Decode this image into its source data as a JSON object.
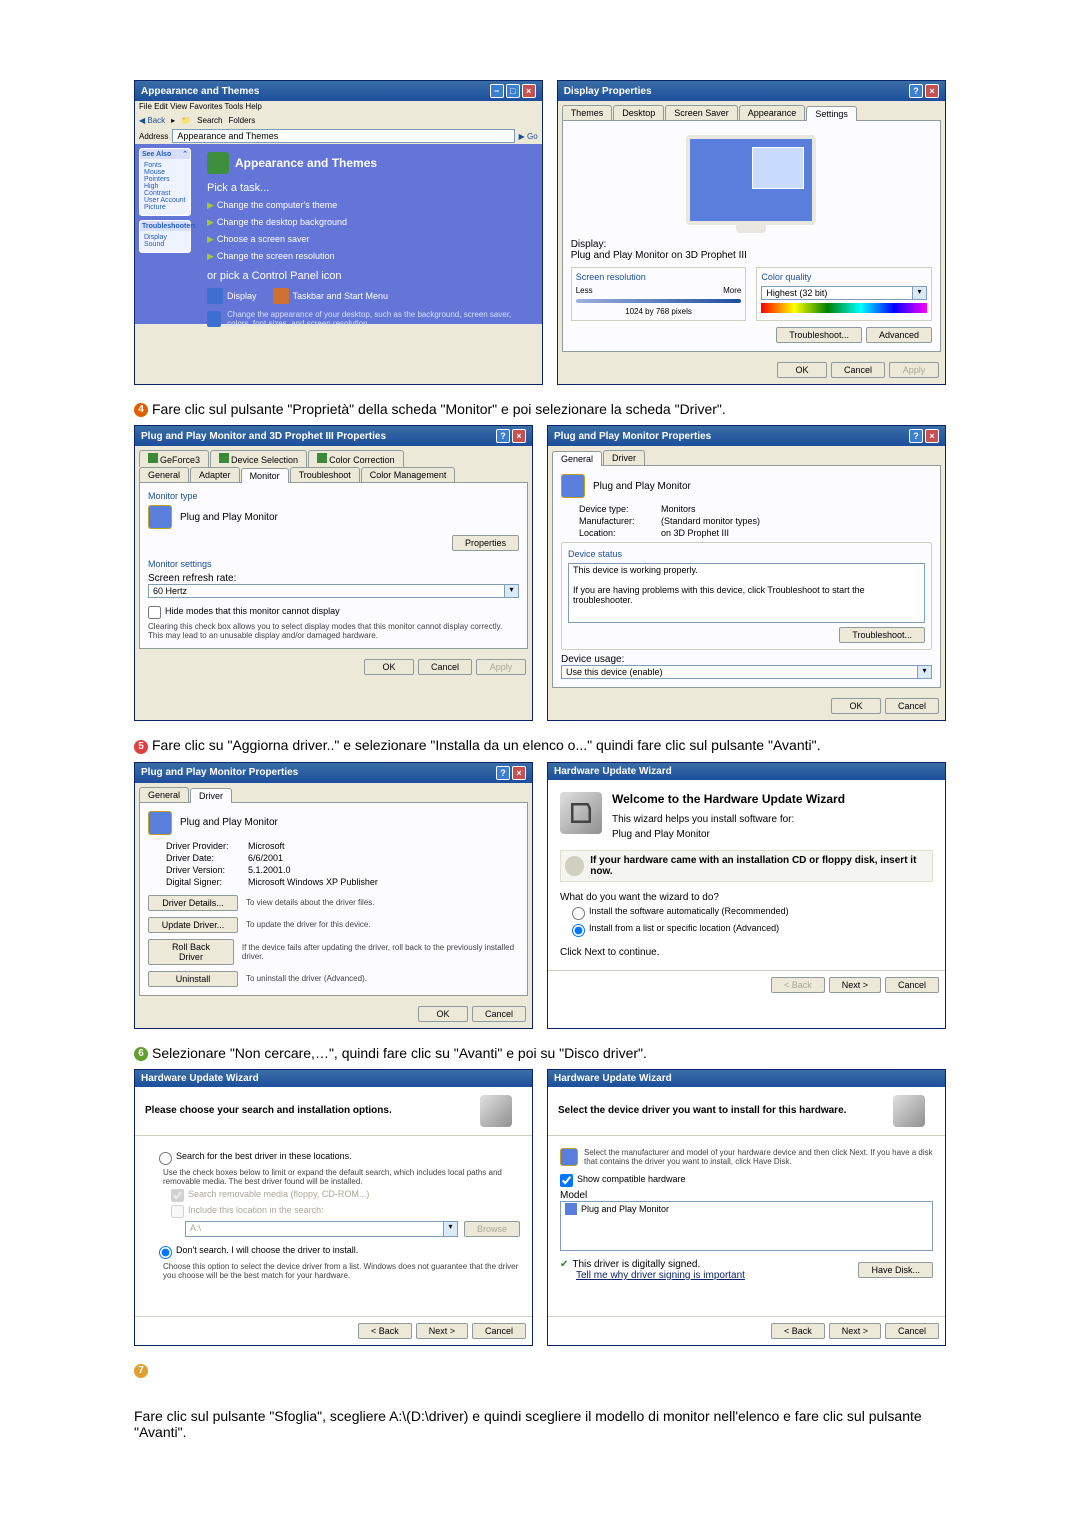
{
  "row1": {
    "controlPanel": {
      "title": "Appearance and Themes",
      "menu": "File  Edit  View  Favorites  Tools  Help",
      "toolbar": {
        "back": "Back",
        "search": "Search",
        "folders": "Folders"
      },
      "address_label": "Address",
      "address_value": "Appearance and Themes",
      "go": "Go",
      "side": {
        "box1_title": "See Also",
        "box1_items": [
          "Fonts",
          "Mouse Pointers",
          "High Contrast",
          "User Account Picture"
        ],
        "box2_title": "Troubleshooters",
        "box2_items": [
          "Display",
          "Sound"
        ]
      },
      "head": "Appearance and Themes",
      "pick_task": "Pick a task...",
      "tasks": [
        "Change the computer's theme",
        "Change the desktop background",
        "Choose a screen saver",
        "Change the screen resolution"
      ],
      "or_pick": "or pick a Control Panel icon",
      "icons": {
        "display": "Display",
        "taskbar": "Taskbar and Start Menu"
      },
      "footer_small": "Change the appearance of your desktop, such as the background, screen saver, colors, font sizes, and screen resolution."
    },
    "displayProps": {
      "title": "Display Properties",
      "tabs": [
        "Themes",
        "Desktop",
        "Screen Saver",
        "Appearance",
        "Settings"
      ],
      "display_label": "Display:",
      "display_value": "Plug and Play Monitor on 3D Prophet III",
      "screen_res": "Screen resolution",
      "less": "Less",
      "more": "More",
      "res_value": "1024 by 768 pixels",
      "color_quality": "Color quality",
      "color_value": "Highest (32 bit)",
      "troubleshoot": "Troubleshoot...",
      "advanced": "Advanced",
      "ok": "OK",
      "cancel": "Cancel",
      "apply": "Apply"
    }
  },
  "step4": {
    "text": "Fare clic sul pulsante \"Proprietà\" della scheda \"Monitor\" e poi selezionare la scheda \"Driver\"."
  },
  "row2": {
    "adapterProps": {
      "title": "Plug and Play Monitor and 3D Prophet III Properties",
      "tabs_top": [
        "GeForce3",
        "Device Selection",
        "Color Correction"
      ],
      "tabs_bottom": [
        "General",
        "Adapter",
        "Monitor",
        "Troubleshoot",
        "Color Management"
      ],
      "monitor_type": "Monitor type",
      "monitor_name": "Plug and Play Monitor",
      "properties": "Properties",
      "monitor_settings": "Monitor settings",
      "refresh_label": "Screen refresh rate:",
      "refresh_value": "60 Hertz",
      "hide_modes": "Hide modes that this monitor cannot display",
      "hide_desc": "Clearing this check box allows you to select display modes that this monitor cannot display correctly. This may lead to an unusable display and/or damaged hardware.",
      "ok": "OK",
      "cancel": "Cancel",
      "apply": "Apply"
    },
    "monitorProps": {
      "title": "Plug and Play Monitor Properties",
      "tabs": [
        "General",
        "Driver"
      ],
      "name": "Plug and Play Monitor",
      "devtype_l": "Device type:",
      "devtype_v": "Monitors",
      "mfr_l": "Manufacturer:",
      "mfr_v": "(Standard monitor types)",
      "loc_l": "Location:",
      "loc_v": "on 3D Prophet III",
      "status_title": "Device status",
      "status_text": "This device is working properly.",
      "status_help": "If you are having problems with this device, click Troubleshoot to start the troubleshooter.",
      "troubleshoot": "Troubleshoot...",
      "usage_label": "Device usage:",
      "usage_value": "Use this device (enable)",
      "ok": "OK",
      "cancel": "Cancel"
    }
  },
  "step5": {
    "text": "Fare clic su \"Aggiorna driver..\" e selezionare \"Installa da un elenco o...\" quindi fare clic sul pulsante \"Avanti\"."
  },
  "row3": {
    "driverTab": {
      "title": "Plug and Play Monitor Properties",
      "tabs": [
        "General",
        "Driver"
      ],
      "name": "Plug and Play Monitor",
      "provider_l": "Driver Provider:",
      "provider_v": "Microsoft",
      "date_l": "Driver Date:",
      "date_v": "6/6/2001",
      "version_l": "Driver Version:",
      "version_v": "5.1.2001.0",
      "signer_l": "Digital Signer:",
      "signer_v": "Microsoft Windows XP Publisher",
      "details": "Driver Details...",
      "details_d": "To view details about the driver files.",
      "update": "Update Driver...",
      "update_d": "To update the driver for this device.",
      "rollback": "Roll Back Driver",
      "rollback_d": "If the device fails after updating the driver, roll back to the previously installed driver.",
      "uninstall": "Uninstall",
      "uninstall_d": "To uninstall the driver (Advanced).",
      "ok": "OK",
      "cancel": "Cancel"
    },
    "wizard1": {
      "title": "Hardware Update Wizard",
      "welcome": "Welcome to the Hardware Update Wizard",
      "helps": "This wizard helps you install software for:",
      "device": "Plug and Play Monitor",
      "cd_note": "If your hardware came with an installation CD or floppy disk, insert it now.",
      "question": "What do you want the wizard to do?",
      "opt1": "Install the software automatically (Recommended)",
      "opt2": "Install from a list or specific location (Advanced)",
      "cont": "Click Next to continue.",
      "back": "< Back",
      "next": "Next >",
      "cancel": "Cancel"
    }
  },
  "step6": {
    "text": "Selezionare \"Non cercare,…\", quindi fare clic su \"Avanti\" e poi su \"Disco driver\"."
  },
  "row4": {
    "wizard2": {
      "title": "Hardware Update Wizard",
      "head": "Please choose your search and installation options.",
      "opt1": "Search for the best driver in these locations.",
      "opt1_desc": "Use the check boxes below to limit or expand the default search, which includes local paths and removable media. The best driver found will be installed.",
      "cb1": "Search removable media (floppy, CD-ROM...)",
      "cb2": "Include this location in the search:",
      "path": "A:\\",
      "browse": "Browse",
      "opt2": "Don't search. I will choose the driver to install.",
      "opt2_desc": "Choose this option to select the device driver from a list. Windows does not guarantee that the driver you choose will be the best match for your hardware.",
      "back": "< Back",
      "next": "Next >",
      "cancel": "Cancel"
    },
    "wizard3": {
      "title": "Hardware Update Wizard",
      "head": "Select the device driver you want to install for this hardware.",
      "desc": "Select the manufacturer and model of your hardware device and then click Next. If you have a disk that contains the driver you want to install, click Have Disk.",
      "compat": "Show compatible hardware",
      "model": "Model",
      "model_item": "Plug and Play Monitor",
      "signed": "This driver is digitally signed.",
      "tellme": "Tell me why driver signing is important",
      "havedisk": "Have Disk...",
      "back": "< Back",
      "next": "Next >",
      "cancel": "Cancel"
    }
  },
  "step7": {
    "text": "Fare clic sul pulsante \"Sfoglia\", scegliere A:\\(D:\\driver) e quindi scegliere il modello di monitor nell'elenco e fare clic sul pulsante \"Avanti\"."
  }
}
